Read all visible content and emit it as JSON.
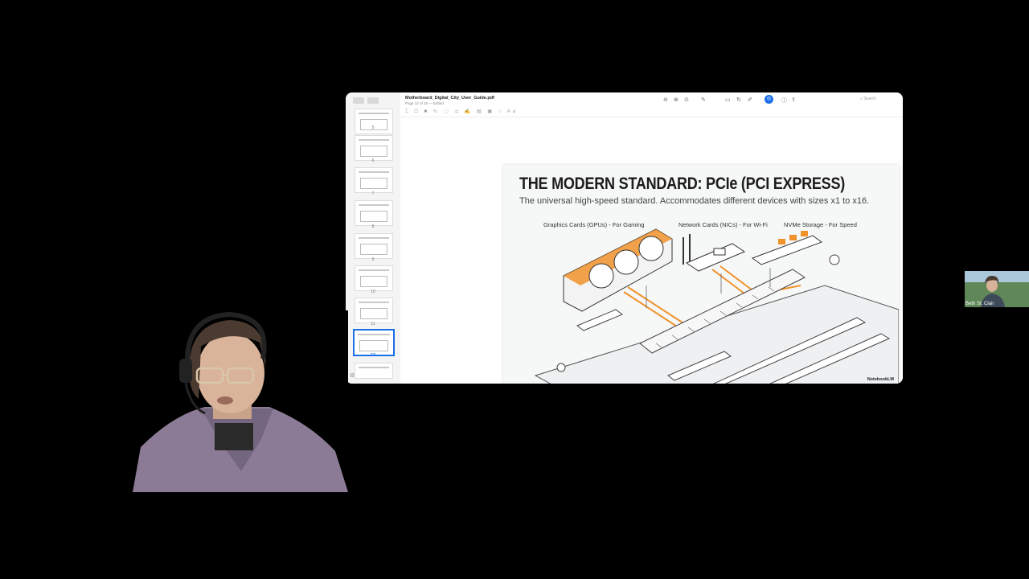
{
  "viewer": {
    "filename": "Motherboard_Digital_City_User_Guide.pdf",
    "page_info": "Page 12 of 18 — Edited",
    "search_placeholder": "Search",
    "thumbnails": [
      {
        "num": "5"
      },
      {
        "num": "6"
      },
      {
        "num": "7"
      },
      {
        "num": "8"
      },
      {
        "num": "9"
      },
      {
        "num": "10"
      },
      {
        "num": "11"
      },
      {
        "num": "12",
        "selected": true
      },
      {
        "num": "13"
      }
    ]
  },
  "slide": {
    "title": "THE MODERN STANDARD: PCIe (PCI EXPRESS)",
    "subtitle": "The universal high-speed standard. Accommodates different devices with sizes x1 to x16.",
    "labels": {
      "gpu": "Graphics Cards (GPUs) - For Gaming",
      "nic": "Network Cards (NICs) - For Wi-Fi",
      "nvme": "NVMe Storage - For Speed"
    },
    "brand": "NotebookLM"
  },
  "participants": {
    "small_name": "Beth St. Clair"
  },
  "colors": {
    "accent": "#1d6fe8",
    "orange": "#f0922a"
  }
}
